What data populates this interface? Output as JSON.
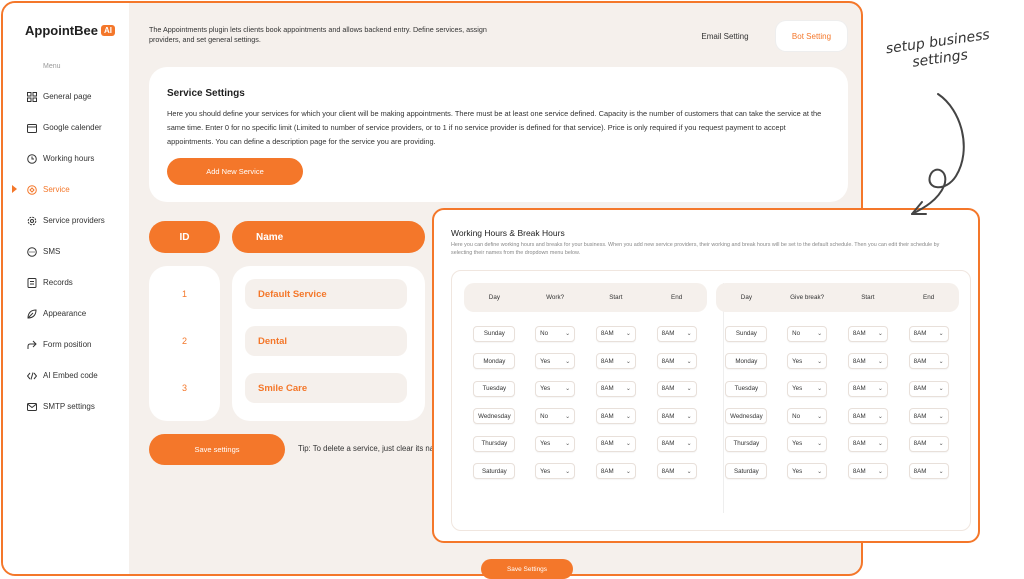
{
  "brand": {
    "name": "AppointBee",
    "badge": "AI"
  },
  "intro_text": "The Appointments plugin lets clients book appointments and allows backend entry. Define services, assign providers, and set general settings.",
  "header": {
    "email_setting": "Email Setting",
    "bot_setting": "Bot Setting"
  },
  "sidebar": {
    "menu_label": "Menu",
    "items": [
      {
        "label": "General page",
        "icon": "grid-icon"
      },
      {
        "label": "Google calender",
        "icon": "calendar-icon"
      },
      {
        "label": "Working hours",
        "icon": "clock-icon"
      },
      {
        "label": "Service",
        "icon": "service-icon",
        "active": true
      },
      {
        "label": "Service providers",
        "icon": "settings-icon"
      },
      {
        "label": "SMS",
        "icon": "chat-icon"
      },
      {
        "label": "Records",
        "icon": "records-icon"
      },
      {
        "label": "Appearance",
        "icon": "leaf-icon"
      },
      {
        "label": "Form position",
        "icon": "form-icon"
      },
      {
        "label": "AI Embed code",
        "icon": "code-icon"
      },
      {
        "label": "SMTP settings",
        "icon": "mail-icon"
      }
    ]
  },
  "service_settings": {
    "title": "Service Settings",
    "description": "Here you should define your services for which your client will be making appointments. There must be at least one service defined. Capacity is the number of customers that can take the service at the same time. Enter 0 for no specific limit (Limited to number of service providers, or to 1 if no service provider is defined for that service). Price is only required if you request payment to accept appointments. You can define a description page for the service you are providing.",
    "add_button": "Add New Service"
  },
  "services_table": {
    "headers": {
      "id": "ID",
      "name": "Name"
    },
    "rows": [
      {
        "id": "1",
        "name": "Default Service"
      },
      {
        "id": "2",
        "name": "Dental"
      },
      {
        "id": "3",
        "name": "Smile Care"
      }
    ]
  },
  "save_button": "Save settings",
  "tip": "Tip: To delete a service, just clear its name",
  "hours_panel": {
    "title": "Working Hours & Break Hours",
    "description": "Here you can define working hours and breaks for your business. When you add new service providers, their working and break hours will be set to the default schedule. Then you can edit their schedule by selecting their names from the dropdown menu below.",
    "work_headers": [
      "Day",
      "Work?",
      "Start",
      "End"
    ],
    "break_headers": [
      "Day",
      "Give break?",
      "Start",
      "End"
    ],
    "work_rows": [
      {
        "day": "Sunday",
        "flag": "No",
        "start": "8AM",
        "end": "8AM"
      },
      {
        "day": "Monday",
        "flag": "Yes",
        "start": "8AM",
        "end": "8AM"
      },
      {
        "day": "Tuesday",
        "flag": "Yes",
        "start": "8AM",
        "end": "8AM"
      },
      {
        "day": "Wednesday",
        "flag": "No",
        "start": "8AM",
        "end": "8AM"
      },
      {
        "day": "Thursday",
        "flag": "Yes",
        "start": "8AM",
        "end": "8AM"
      },
      {
        "day": "Saturday",
        "flag": "Yes",
        "start": "8AM",
        "end": "8AM"
      }
    ],
    "break_rows": [
      {
        "day": "Sunday",
        "flag": "No",
        "start": "8AM",
        "end": "8AM"
      },
      {
        "day": "Monday",
        "flag": "Yes",
        "start": "8AM",
        "end": "8AM"
      },
      {
        "day": "Tuesday",
        "flag": "Yes",
        "start": "8AM",
        "end": "8AM"
      },
      {
        "day": "Wednesday",
        "flag": "No",
        "start": "8AM",
        "end": "8AM"
      },
      {
        "day": "Thursday",
        "flag": "Yes",
        "start": "8AM",
        "end": "8AM"
      },
      {
        "day": "Saturday",
        "flag": "Yes",
        "start": "8AM",
        "end": "8AM"
      }
    ],
    "save_button": "Save Settings"
  },
  "annotation": {
    "line1": "setup business",
    "line2": "settings"
  },
  "colors": {
    "accent": "#f4772a",
    "background": "#f5f0ec"
  }
}
